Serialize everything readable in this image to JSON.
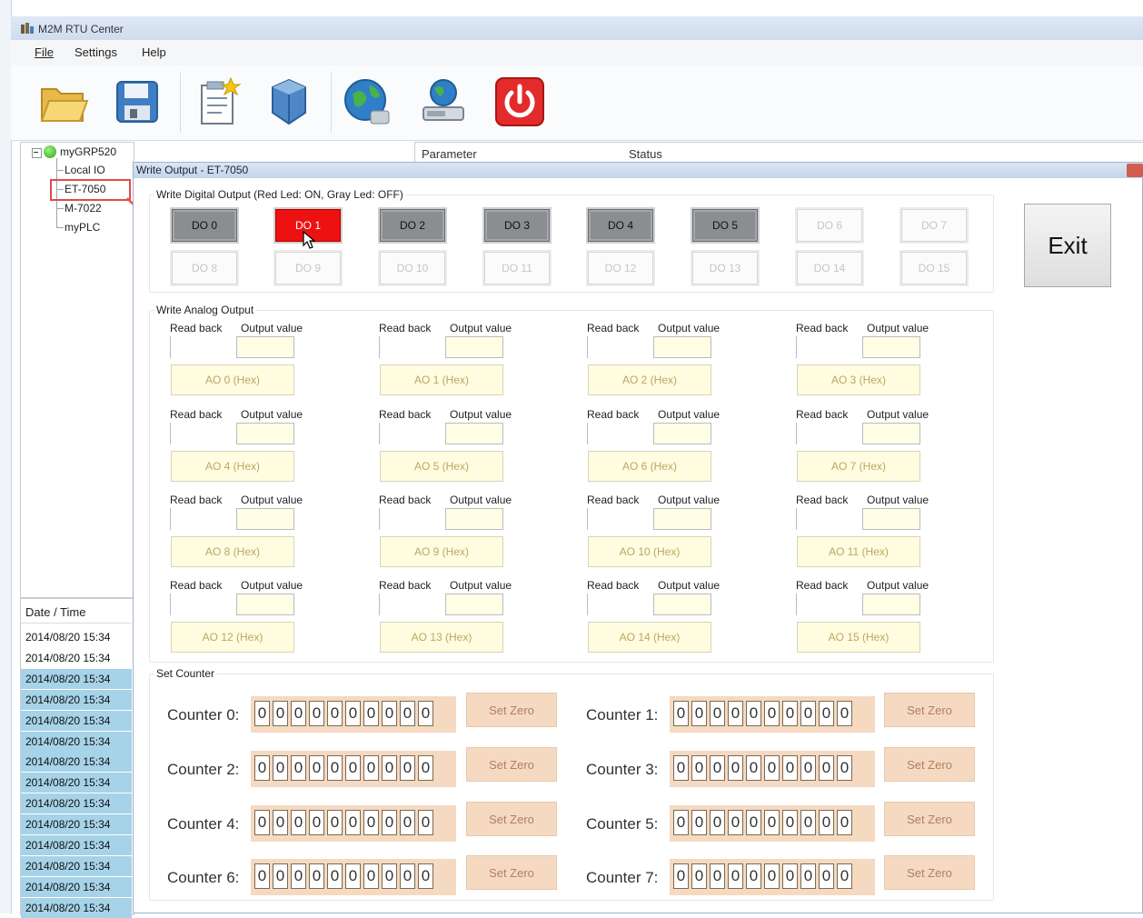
{
  "app": {
    "title": "M2M RTU Center"
  },
  "menu": [
    "File",
    "Settings",
    "Help"
  ],
  "toolbar": [
    {
      "name": "open-folder-icon"
    },
    {
      "name": "save-icon"
    },
    {
      "name": "new-project-icon"
    },
    {
      "name": "module-icon"
    },
    {
      "name": "web-globe-icon"
    },
    {
      "name": "network-drive-icon"
    },
    {
      "name": "power-icon"
    }
  ],
  "tree": {
    "root": "myGRP520",
    "items": [
      "Local IO",
      "ET-7050",
      "M-7022",
      "myPLC"
    ]
  },
  "param_header": {
    "col1": "Parameter",
    "col2": "Status"
  },
  "log": {
    "header": "Date / Time",
    "rows": [
      "2014/08/20 15:34",
      "2014/08/20 15:34",
      "2014/08/20 15:34",
      "2014/08/20 15:34",
      "2014/08/20 15:34",
      "2014/08/20 15:34",
      "2014/08/20 15:34",
      "2014/08/20 15:34",
      "2014/08/20 15:34",
      "2014/08/20 15:34",
      "2014/08/20 15:34",
      "2014/08/20 15:34",
      "2014/08/20 15:34",
      "2014/08/20 15:34"
    ]
  },
  "dialog": {
    "title": "Write Output - ET-7050",
    "do_group_label": "Write Digital Output  (Red Led: ON, Gray Led: OFF)",
    "do_buttons": [
      "DO 0",
      "DO 1",
      "DO 2",
      "DO 3",
      "DO 4",
      "DO 5",
      "DO 6",
      "DO 7",
      "DO 8",
      "DO 9",
      "DO 10",
      "DO 11",
      "DO 12",
      "DO 13",
      "DO 14",
      "DO 15"
    ],
    "ao_group_label": "Write Analog Output",
    "ao_read_label": "Read back",
    "ao_output_label": "Output value",
    "ao_buttons": [
      "AO 0 (Hex)",
      "AO 1 (Hex)",
      "AO 2 (Hex)",
      "AO 3 (Hex)",
      "AO 4 (Hex)",
      "AO 5 (Hex)",
      "AO 6 (Hex)",
      "AO 7 (Hex)",
      "AO 8 (Hex)",
      "AO 9 (Hex)",
      "AO 10 (Hex)",
      "AO 11 (Hex)",
      "AO 12 (Hex)",
      "AO 13 (Hex)",
      "AO 14 (Hex)",
      "AO 15 (Hex)"
    ],
    "counter_group_label": "Set Counter",
    "counters": [
      "Counter 0:",
      "Counter 1:",
      "Counter 2:",
      "Counter 3:",
      "Counter 4:",
      "Counter 5:",
      "Counter 6:",
      "Counter 7:"
    ],
    "counter_digits": [
      "0",
      "0",
      "0",
      "0",
      "0",
      "0",
      "0",
      "0",
      "0",
      "0"
    ],
    "set_zero_label": "Set Zero",
    "exit_label": "Exit"
  },
  "colors": {
    "do_on": "#ee1111",
    "do_off_gray": "#8b8d90",
    "log_selected": "#a6d3e8"
  }
}
